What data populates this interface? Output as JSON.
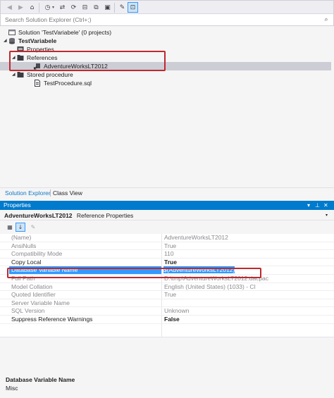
{
  "solution_explorer": {
    "search_placeholder": "Search Solution Explorer (Ctrl+;)",
    "tree": {
      "solution": "Solution 'TestVariabele' (0 projects)",
      "project": "TestVariabele",
      "properties": "Properties",
      "references": "References",
      "reference_item": "AdventureWorksLT2012",
      "stored_procedure_folder": "Stored procedure",
      "sql_file": "TestProcedure.sql"
    },
    "tabs": [
      "Solution Explorer",
      "Class View"
    ]
  },
  "properties": {
    "header": "Properties",
    "object_name": "AdventureWorksLT2012",
    "object_type": "Reference Properties",
    "rows": [
      {
        "name": "(Name)",
        "value": "AdventureWorksLT2012"
      },
      {
        "name": "AnsiNulls",
        "value": "True"
      },
      {
        "name": "Compatibility Mode",
        "value": "110"
      },
      {
        "name": "Copy Local",
        "value": "True"
      },
      {
        "name": "Database Variable Name",
        "value": "$(AdventureWorksLT2012)"
      },
      {
        "name": "Full Path",
        "value": "D:\\tmp\\AdventureWorksLT2012.dacpac"
      },
      {
        "name": "Model Collation",
        "value": "English (United States) (1033) - CI"
      },
      {
        "name": "Quoted Identifier",
        "value": "True"
      },
      {
        "name": "Server Variable Name",
        "value": ""
      },
      {
        "name": "SQL Version",
        "value": "Unknown"
      },
      {
        "name": "Suppress Reference Warnings",
        "value": "False"
      }
    ],
    "description": {
      "title": "Database Variable Name",
      "text": "Misc"
    }
  },
  "colors": {
    "accent": "#007acc",
    "selection": "#3399ff",
    "highlight_box": "#c0282d",
    "tab_active": "#1177c7"
  }
}
